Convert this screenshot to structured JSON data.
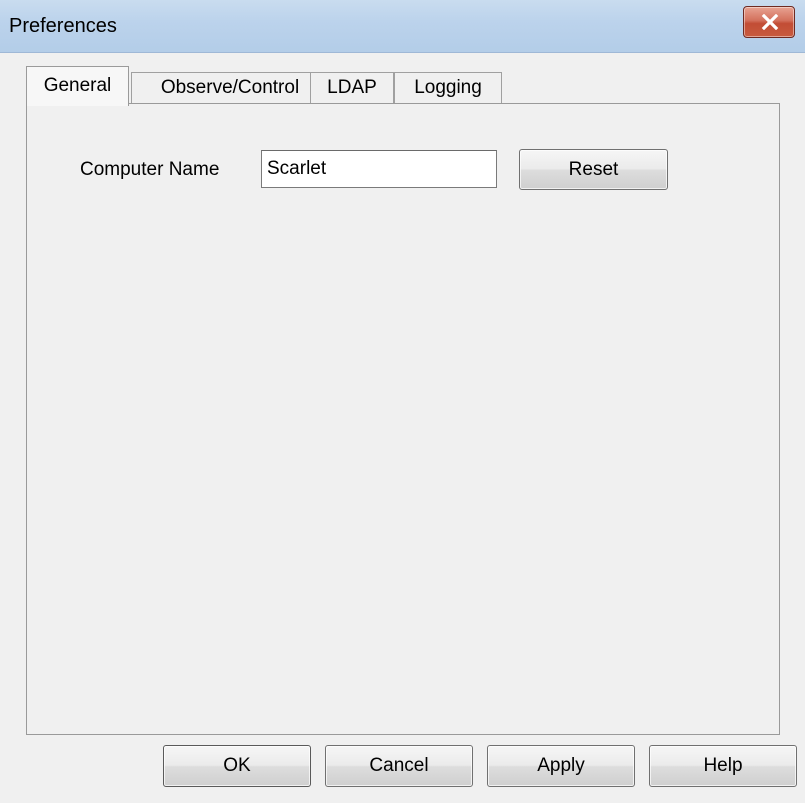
{
  "window": {
    "title": "Preferences",
    "close_icon": "close-icon"
  },
  "tabs": [
    {
      "label": "General",
      "active": true
    },
    {
      "label": "Observe/Control",
      "active": false
    },
    {
      "label": "LDAP",
      "active": false
    },
    {
      "label": "Logging",
      "active": false
    }
  ],
  "general": {
    "computer_name_label": "Computer Name",
    "computer_name_value": "Scarlet",
    "reset_label": "Reset"
  },
  "footer": {
    "ok_label": "OK",
    "cancel_label": "Cancel",
    "apply_label": "Apply",
    "help_label": "Help"
  },
  "colors": {
    "titlebar": "#bcd3ec",
    "close_button": "#c24d35",
    "dialog_background": "#f0f0f0"
  }
}
